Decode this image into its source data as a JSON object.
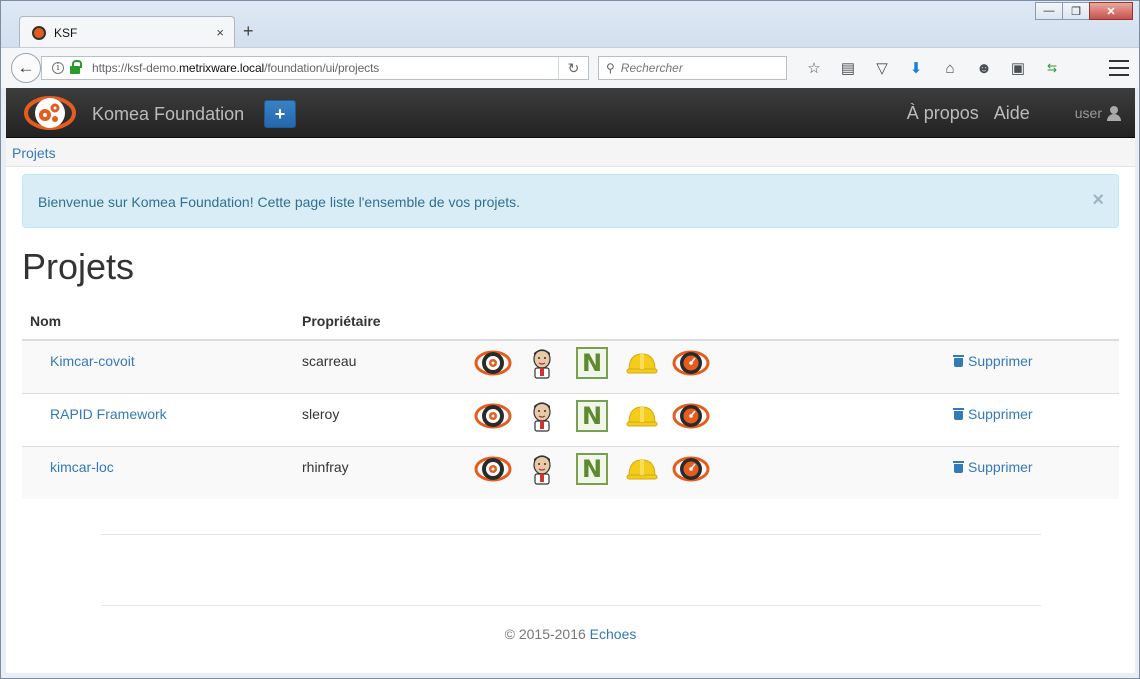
{
  "browser": {
    "tab_title": "KSF",
    "tab_close": "×",
    "new_tab": "+",
    "url_host_prefix": "https://ksf-demo.",
    "url_host_main": "metrixware.local",
    "url_path": "/foundation/ui/projects",
    "search_placeholder": "Rechercher",
    "window_controls": [
      "minimize-icon",
      "restore-icon",
      "close-icon"
    ],
    "toolbar_icons": [
      "star-icon",
      "reading-list-icon",
      "pocket-icon",
      "download-icon",
      "home-icon",
      "emoji-icon",
      "screenshot-icon",
      "sync-icon"
    ]
  },
  "navbar": {
    "brand": "Komea Foundation",
    "add_label": "+",
    "about": "À propos",
    "help": "Aide",
    "user": "user"
  },
  "breadcrumb": "Projets",
  "alert": {
    "text": "Bienvenue sur Komea Foundation! Cette page liste l'ensemble de vos projets.",
    "close": "×"
  },
  "page_title": "Projets",
  "table": {
    "headers": [
      "Nom",
      "Propriétaire",
      "",
      ""
    ],
    "rows": [
      {
        "name": "Kimcar-covoit",
        "owner": "scarreau",
        "action": "Supprimer"
      },
      {
        "name": "RAPID Framework",
        "owner": "sleroy",
        "action": "Supprimer"
      },
      {
        "name": "kimcar-loc",
        "owner": "rhinfray",
        "action": "Supprimer"
      }
    ],
    "tool_icons": [
      "komea-icon",
      "jenkins-icon",
      "nexus-icon",
      "sonar-helmet-icon",
      "komea-dashboard-icon"
    ],
    "nexus_letter": "N"
  },
  "footer": {
    "copyright": "© 2015-2016",
    "company": "Echoes"
  },
  "colors": {
    "navbar": "#222222",
    "link": "#337ab7",
    "alert_bg": "#d9edf7",
    "alert_text": "#31708f",
    "komea_orange": "#e45c1f"
  }
}
